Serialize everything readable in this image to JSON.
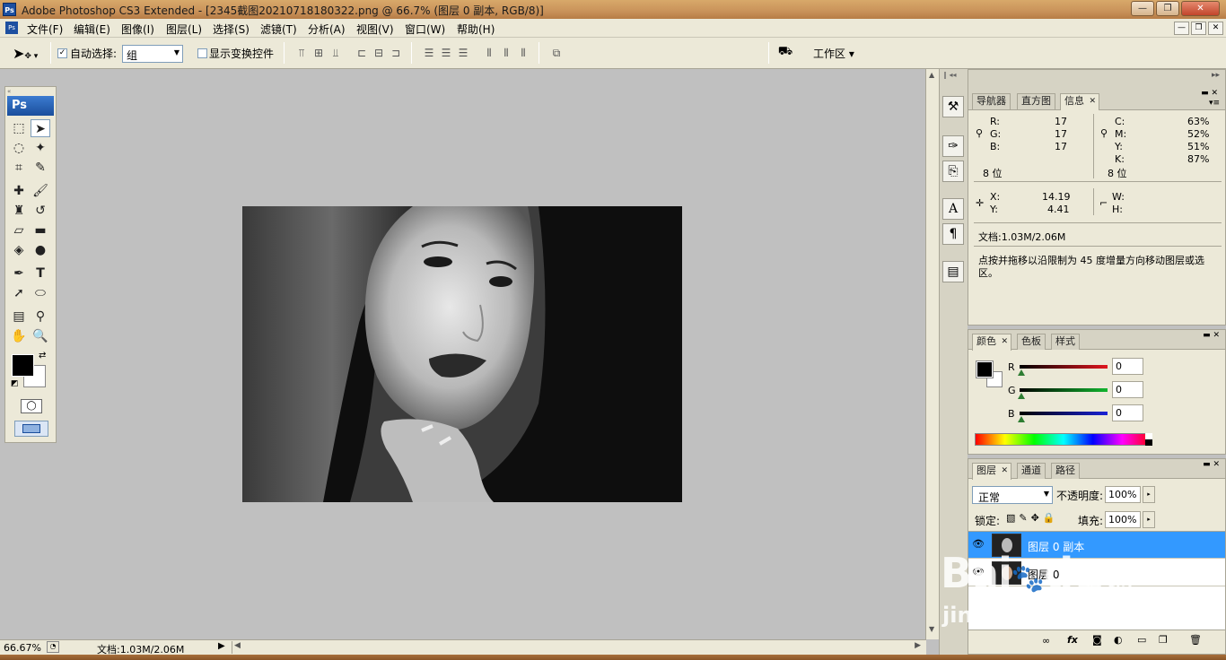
{
  "window": {
    "app_icon": "Ps",
    "title": "Adobe Photoshop CS3 Extended - [2345截图20210718180322.png @ 66.7% (图层 0 副本, RGB/8)]",
    "controls": {
      "minimize": "—",
      "restore": "❐",
      "close": "✕"
    }
  },
  "menu": {
    "items": [
      "文件(F)",
      "编辑(E)",
      "图像(I)",
      "图层(L)",
      "选择(S)",
      "滤镜(T)",
      "分析(A)",
      "视图(V)",
      "窗口(W)",
      "帮助(H)"
    ],
    "doc_controls": {
      "minimize": "—",
      "restore": "❐",
      "close": "✕"
    }
  },
  "options": {
    "auto_select_label": "自动选择:",
    "auto_select_checked": "✓",
    "auto_select_value": "组",
    "show_transform_label": "显示变换控件",
    "workspace_label": "工作区 ▾"
  },
  "toolbox": {
    "logo": "Ps"
  },
  "status": {
    "zoom": "66.67%",
    "doc_info": "文档:1.03M/2.06M"
  },
  "info_panel": {
    "tabs": [
      "导航器",
      "直方图",
      "信息"
    ],
    "active_tab_close": "✕",
    "rgb": {
      "r_label": "R:",
      "r": "17",
      "g_label": "G:",
      "g": "17",
      "b_label": "B:",
      "b": "17",
      "bits": "8 位"
    },
    "cmyk": {
      "c_label": "C:",
      "c": "63%",
      "m_label": "M:",
      "m": "52%",
      "y_label": "Y:",
      "y": "51%",
      "k_label": "K:",
      "k": "87%",
      "bits": "8 位"
    },
    "coords": {
      "x_label": "X:",
      "x": "14.19",
      "y_label": "Y:",
      "y": "4.41",
      "w_label": "W:",
      "h_label": "H:"
    },
    "doc": "文档:1.03M/2.06M",
    "hint": "点按并拖移以沿限制为 45 度增量方向移动图层或选区。"
  },
  "color_panel": {
    "tabs": [
      "颜色",
      "色板",
      "样式"
    ],
    "r_label": "R",
    "r": "0",
    "g_label": "G",
    "g": "0",
    "b_label": "B",
    "b": "0"
  },
  "layers_panel": {
    "tabs": [
      "图层",
      "通道",
      "路径"
    ],
    "blend_mode": "正常",
    "opacity_label": "不透明度:",
    "opacity": "100%",
    "lock_label": "锁定:",
    "fill_label": "填充:",
    "fill": "100%",
    "layers": [
      {
        "name": "图层 0 副本",
        "selected": true
      },
      {
        "name": "图层 0",
        "selected": false
      }
    ]
  },
  "watermark": {
    "brand": "Bai",
    "brand_after": "du",
    "service": "经验",
    "url": "jingyan.baidu.com"
  },
  "colors": {
    "accent": "#3399ff",
    "title_bg": "#c9925a",
    "chrome": "#ece9d8"
  }
}
